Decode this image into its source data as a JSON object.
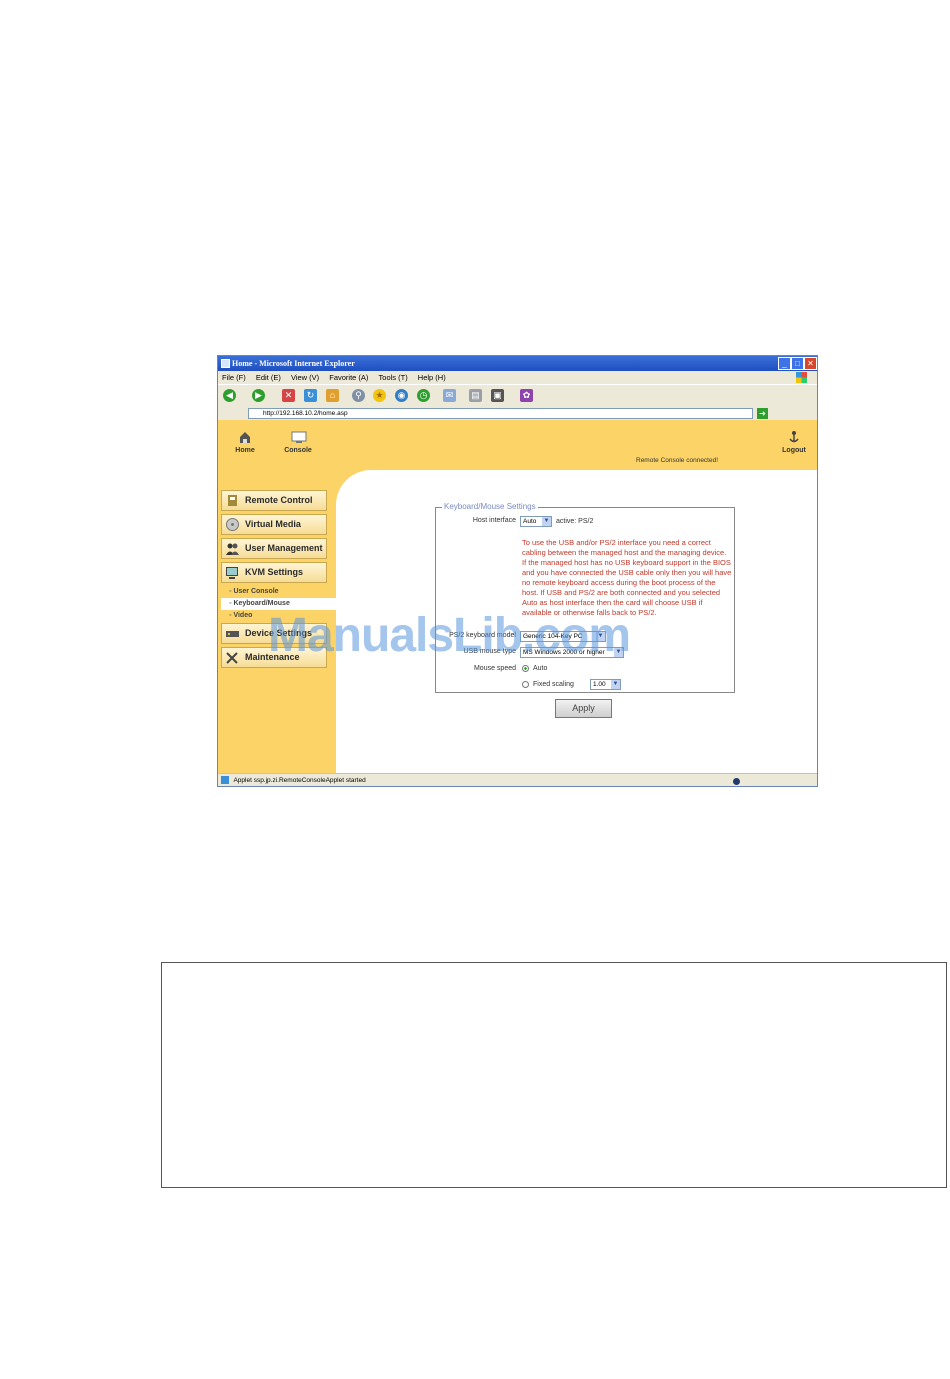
{
  "browser": {
    "title": "Home - Microsoft Internet Explorer",
    "menu": [
      "File (F)",
      "Edit (E)",
      "View (V)",
      "Favorite (A)",
      "Tools (T)",
      "Help (H)"
    ],
    "address": "http://192.168.10.2/home.asp",
    "status": "Applet ssp.jp.zi.RemoteConsoleApplet started"
  },
  "topnav": {
    "home_label": "Home",
    "console_label": "Console",
    "logout_label": "Logout",
    "status_text": "Remote Console connected!"
  },
  "sidebar": {
    "items": [
      {
        "label": "Remote Control"
      },
      {
        "label": "Virtual Media"
      },
      {
        "label": "User Management"
      },
      {
        "label": "KVM Settings"
      },
      {
        "label": "Device Settings"
      },
      {
        "label": "Maintenance"
      }
    ],
    "sub": [
      "User Console",
      "Keyboard/Mouse",
      "Video"
    ]
  },
  "form": {
    "legend": "Keyboard/Mouse Settings",
    "host_interface_label": "Host interface",
    "host_interface_value": "Auto",
    "active_text": "active: PS/2",
    "warning": "To use the USB and/or PS/2 interface you need a correct cabling between the managed host and the managing device. If the managed host has no USB keyboard support in the BIOS and you have connected the USB cable only then you will have no remote keyboard access during the boot process of the host. If USB and PS/2 are both connected and you selected Auto as host interface then the card will choose USB if available or otherwise falls back to PS/2.",
    "ps2_label": "PS/2 keyboard model",
    "ps2_value": "Generic 104-Key PC",
    "usb_label": "USB mouse type",
    "usb_value": "MS Windows 2000 or higher",
    "mouse_speed_label": "Mouse speed",
    "auto_label": "Auto",
    "fixed_label": "Fixed scaling",
    "fixed_value": "1.00",
    "apply_label": "Apply"
  },
  "watermark": "ManualsLib.com"
}
